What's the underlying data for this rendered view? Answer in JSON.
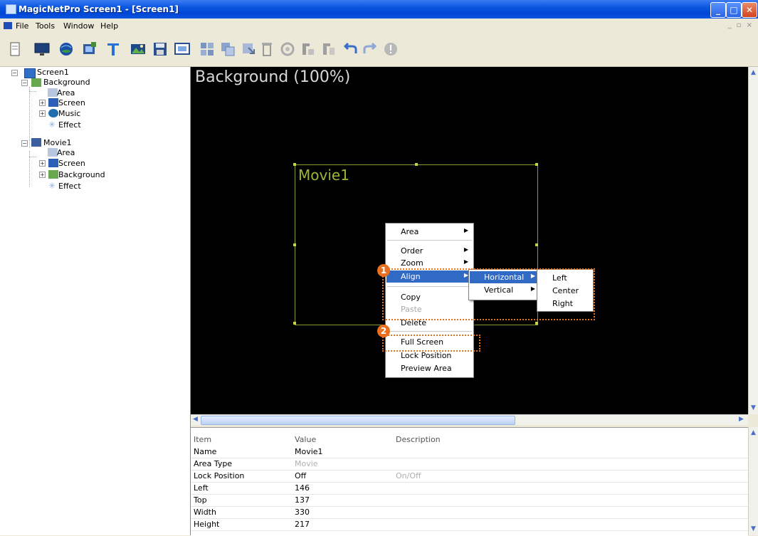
{
  "window": {
    "title": "MagicNetPro Screen1 - [Screen1]"
  },
  "menu": {
    "file": "File",
    "tools": "Tools",
    "window": "Window",
    "help": "Help",
    "mdi_controls": "_ ▫ ×"
  },
  "toolbar": {
    "icons": [
      "new-icon",
      "monitor-icon",
      "globe-icon",
      "film-icon",
      "text-icon",
      "image-icon",
      "save-icon",
      "screen-icon",
      "grid-icon",
      "layers-icon",
      "import-icon",
      "trash-icon",
      "settings-icon",
      "align-icon",
      "distribute-icon",
      "undo-icon",
      "redo-icon",
      "info-icon"
    ]
  },
  "tree": {
    "root": "Screen1",
    "background": "Background",
    "bg_area": "Area",
    "bg_screen": "Screen",
    "bg_music": "Music",
    "bg_effect": "Effect",
    "movie": "Movie1",
    "mv_area": "Area",
    "mv_screen": "Screen",
    "mv_background": "Background",
    "mv_effect": "Effect"
  },
  "canvas": {
    "background_label": "Background (100%)",
    "movie_label": "Movie1"
  },
  "context_menu": {
    "area": "Area",
    "order": "Order",
    "zoom": "Zoom",
    "align": "Align",
    "copy": "Copy",
    "paste": "Paste",
    "delete": "Delete",
    "full_screen": "Full Screen",
    "lock_position": "Lock Position",
    "preview_area": "Preview Area"
  },
  "align_submenu": {
    "horizontal": "Horizontal",
    "vertical": "Vertical"
  },
  "horizontal_submenu": {
    "left": "Left",
    "center": "Center",
    "right": "Right"
  },
  "badges": {
    "one": "1",
    "two": "2"
  },
  "properties": {
    "headers": {
      "item": "Item",
      "value": "Value",
      "description": "Description"
    },
    "rows": [
      {
        "item": "Name",
        "value": "Movie1",
        "description": ""
      },
      {
        "item": "Area Type",
        "value": "Movie",
        "description": ""
      },
      {
        "item": "Lock Position",
        "value": "Off",
        "description": "On/Off"
      },
      {
        "item": "Left",
        "value": "146",
        "description": ""
      },
      {
        "item": "Top",
        "value": "137",
        "description": ""
      },
      {
        "item": "Width",
        "value": "330",
        "description": ""
      },
      {
        "item": "Height",
        "value": "217",
        "description": ""
      }
    ]
  },
  "colors": {
    "accent": "#316ac5",
    "highlight": "#e2731c",
    "movie_label": "#9ab832"
  }
}
